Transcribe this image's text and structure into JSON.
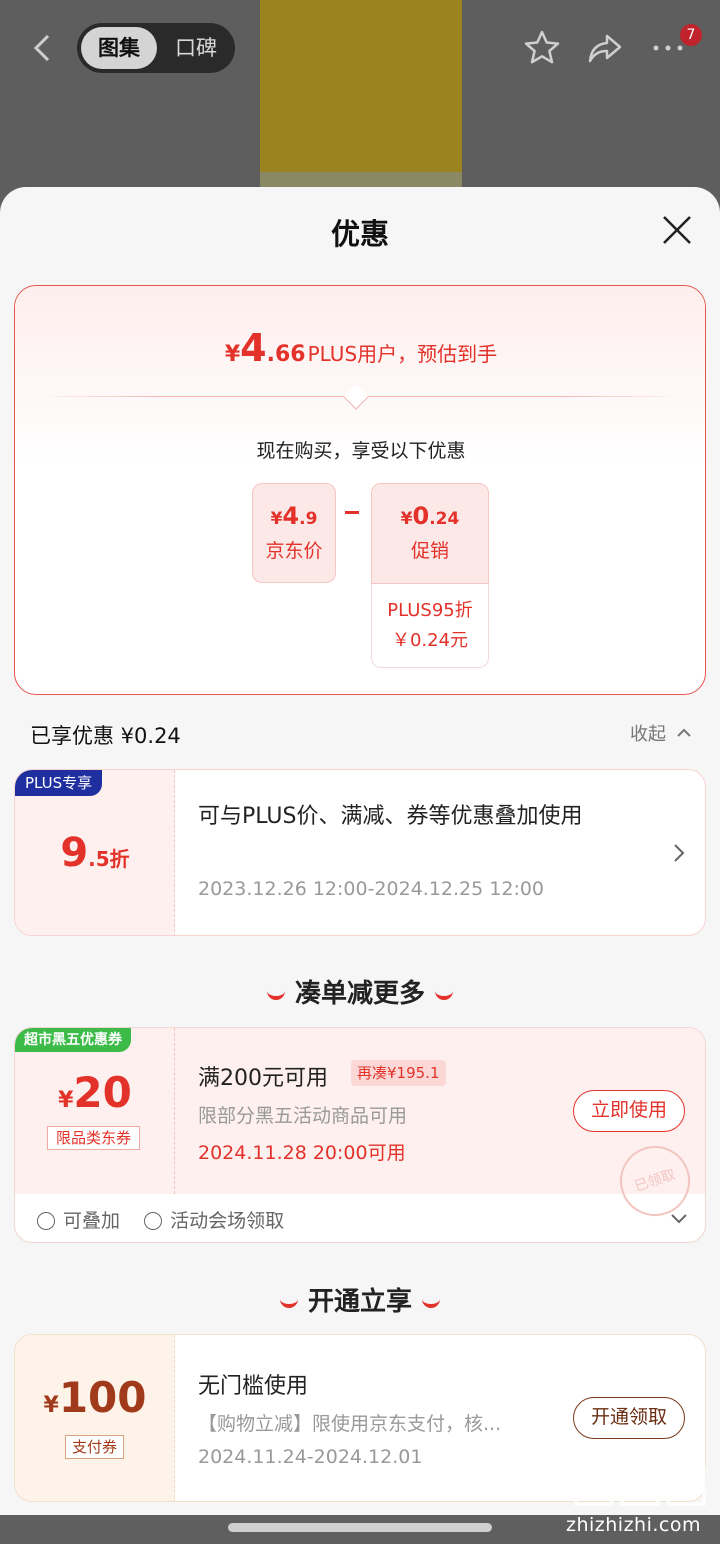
{
  "topbar": {
    "tab_gallery": "图集",
    "tab_reviews": "口碑",
    "badge_count": "7"
  },
  "sheet": {
    "title": "优惠"
  },
  "estimate": {
    "currency": "¥",
    "price_int": "4",
    "price_dec": ".66",
    "label": "PLUS用户，预估到手",
    "subtitle": "现在购买，享受以下优惠",
    "jd_price": {
      "currency": "¥",
      "int": "4",
      "dec": ".9",
      "label": "京东价"
    },
    "promo": {
      "currency": "¥",
      "int": "0",
      "dec": ".24",
      "label": "促销"
    },
    "promo_detail_line1": "PLUS95折",
    "promo_detail_line2": "￥0.24元"
  },
  "enjoyed": {
    "text": "已享优惠 ¥0.24",
    "collapse": "收起"
  },
  "plus_card": {
    "tag": "PLUS专享",
    "discount_int": "9",
    "discount_suffix": ".5折",
    "description": "可与PLUS价、满减、券等优惠叠加使用",
    "date_range": "2023.12.26 12:00-2024.12.25 12:00"
  },
  "section_more": "凑单减更多",
  "coupon1": {
    "tag": "超市黑五优惠券",
    "currency": "¥",
    "amount": "20",
    "type": "限品类东券",
    "title": "满200元可用",
    "extra": "再凑¥195.1",
    "subtitle": "限部分黑五活动商品可用",
    "date": "2024.11.28 20:00可用",
    "button": "立即使用",
    "stamp": "已领取",
    "foot_stack": "可叠加",
    "foot_source": "活动会场领取"
  },
  "section_open": "开通立享",
  "coupon2": {
    "currency": "¥",
    "amount": "100",
    "type": "支付券",
    "title": "无门槛使用",
    "subtitle": "【购物立减】限使用京东支付，核...",
    "date": "2024.11.24-2024.12.01",
    "button": "开通领取"
  },
  "watermark": {
    "site": "zhizhizhi.com"
  },
  "colors": {
    "accent": "#e3322a",
    "plus_tag": "#1f2fa0",
    "green_tag": "#3dbb48",
    "pay_brown": "#a13a1a"
  }
}
